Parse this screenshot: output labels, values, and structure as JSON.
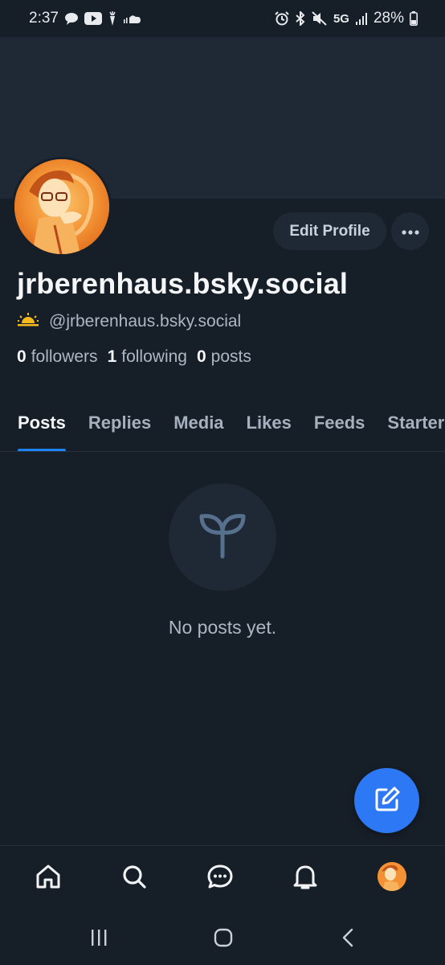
{
  "status_bar": {
    "time": "2:37",
    "network": "5G",
    "battery": "28%",
    "left_icons": [
      "chat-bubble-icon",
      "youtube-icon",
      "carrot-icon",
      "soundcloud-icon"
    ],
    "right_icons": [
      "alarm-icon",
      "bluetooth-icon",
      "mute-icon",
      "signal-icon",
      "battery-icon"
    ]
  },
  "profile": {
    "display_name": "jrberenhaus.bsky.social",
    "handle": "@jrberenhaus.bsky.social",
    "handle_emoji": "sunrise-icon",
    "stats": {
      "followers_count": "0",
      "followers_label": "followers",
      "following_count": "1",
      "following_label": "following",
      "posts_count": "0",
      "posts_label": "posts"
    },
    "edit_button": "Edit Profile",
    "more_icon": "ellipsis-icon"
  },
  "tabs": [
    {
      "label": "Posts",
      "active": true
    },
    {
      "label": "Replies",
      "active": false
    },
    {
      "label": "Media",
      "active": false
    },
    {
      "label": "Likes",
      "active": false
    },
    {
      "label": "Feeds",
      "active": false
    },
    {
      "label": "Starter Packs",
      "active": false
    }
  ],
  "empty_state": {
    "icon": "seedling-icon",
    "text": "No posts yet."
  },
  "fab": {
    "icon": "compose-icon"
  },
  "bottom_nav": [
    "home-icon",
    "search-icon",
    "chat-icon",
    "bell-icon",
    "profile-avatar"
  ],
  "system_nav": [
    "recents-icon",
    "home-circle-icon",
    "back-icon"
  ],
  "colors": {
    "background": "#161e27",
    "surface": "#1e2935",
    "accent": "#1d82f6",
    "fab": "#2d78f5",
    "text_primary": "#f5f6f8",
    "text_secondary": "#aeb8c4"
  }
}
